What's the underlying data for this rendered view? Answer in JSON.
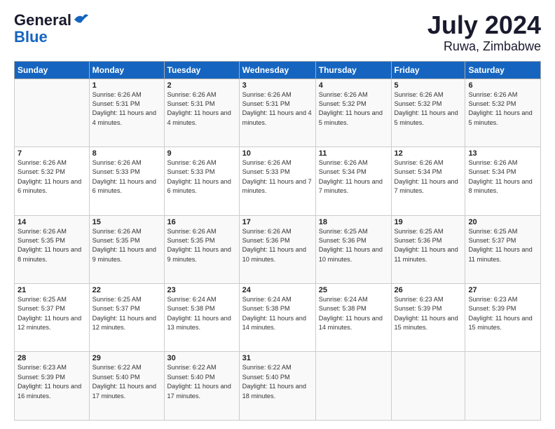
{
  "header": {
    "logo_general": "General",
    "logo_blue": "Blue",
    "title": "July 2024",
    "subtitle": "Ruwa, Zimbabwe"
  },
  "days_of_week": [
    "Sunday",
    "Monday",
    "Tuesday",
    "Wednesday",
    "Thursday",
    "Friday",
    "Saturday"
  ],
  "weeks": [
    [
      {
        "day": "",
        "sunrise": "",
        "sunset": "",
        "daylight": ""
      },
      {
        "day": "1",
        "sunrise": "Sunrise: 6:26 AM",
        "sunset": "Sunset: 5:31 PM",
        "daylight": "Daylight: 11 hours and 4 minutes."
      },
      {
        "day": "2",
        "sunrise": "Sunrise: 6:26 AM",
        "sunset": "Sunset: 5:31 PM",
        "daylight": "Daylight: 11 hours and 4 minutes."
      },
      {
        "day": "3",
        "sunrise": "Sunrise: 6:26 AM",
        "sunset": "Sunset: 5:31 PM",
        "daylight": "Daylight: 11 hours and 4 minutes."
      },
      {
        "day": "4",
        "sunrise": "Sunrise: 6:26 AM",
        "sunset": "Sunset: 5:32 PM",
        "daylight": "Daylight: 11 hours and 5 minutes."
      },
      {
        "day": "5",
        "sunrise": "Sunrise: 6:26 AM",
        "sunset": "Sunset: 5:32 PM",
        "daylight": "Daylight: 11 hours and 5 minutes."
      },
      {
        "day": "6",
        "sunrise": "Sunrise: 6:26 AM",
        "sunset": "Sunset: 5:32 PM",
        "daylight": "Daylight: 11 hours and 5 minutes."
      }
    ],
    [
      {
        "day": "7",
        "sunrise": "Sunrise: 6:26 AM",
        "sunset": "Sunset: 5:32 PM",
        "daylight": "Daylight: 11 hours and 6 minutes."
      },
      {
        "day": "8",
        "sunrise": "Sunrise: 6:26 AM",
        "sunset": "Sunset: 5:33 PM",
        "daylight": "Daylight: 11 hours and 6 minutes."
      },
      {
        "day": "9",
        "sunrise": "Sunrise: 6:26 AM",
        "sunset": "Sunset: 5:33 PM",
        "daylight": "Daylight: 11 hours and 6 minutes."
      },
      {
        "day": "10",
        "sunrise": "Sunrise: 6:26 AM",
        "sunset": "Sunset: 5:33 PM",
        "daylight": "Daylight: 11 hours and 7 minutes."
      },
      {
        "day": "11",
        "sunrise": "Sunrise: 6:26 AM",
        "sunset": "Sunset: 5:34 PM",
        "daylight": "Daylight: 11 hours and 7 minutes."
      },
      {
        "day": "12",
        "sunrise": "Sunrise: 6:26 AM",
        "sunset": "Sunset: 5:34 PM",
        "daylight": "Daylight: 11 hours and 7 minutes."
      },
      {
        "day": "13",
        "sunrise": "Sunrise: 6:26 AM",
        "sunset": "Sunset: 5:34 PM",
        "daylight": "Daylight: 11 hours and 8 minutes."
      }
    ],
    [
      {
        "day": "14",
        "sunrise": "Sunrise: 6:26 AM",
        "sunset": "Sunset: 5:35 PM",
        "daylight": "Daylight: 11 hours and 8 minutes."
      },
      {
        "day": "15",
        "sunrise": "Sunrise: 6:26 AM",
        "sunset": "Sunset: 5:35 PM",
        "daylight": "Daylight: 11 hours and 9 minutes."
      },
      {
        "day": "16",
        "sunrise": "Sunrise: 6:26 AM",
        "sunset": "Sunset: 5:35 PM",
        "daylight": "Daylight: 11 hours and 9 minutes."
      },
      {
        "day": "17",
        "sunrise": "Sunrise: 6:26 AM",
        "sunset": "Sunset: 5:36 PM",
        "daylight": "Daylight: 11 hours and 10 minutes."
      },
      {
        "day": "18",
        "sunrise": "Sunrise: 6:25 AM",
        "sunset": "Sunset: 5:36 PM",
        "daylight": "Daylight: 11 hours and 10 minutes."
      },
      {
        "day": "19",
        "sunrise": "Sunrise: 6:25 AM",
        "sunset": "Sunset: 5:36 PM",
        "daylight": "Daylight: 11 hours and 11 minutes."
      },
      {
        "day": "20",
        "sunrise": "Sunrise: 6:25 AM",
        "sunset": "Sunset: 5:37 PM",
        "daylight": "Daylight: 11 hours and 11 minutes."
      }
    ],
    [
      {
        "day": "21",
        "sunrise": "Sunrise: 6:25 AM",
        "sunset": "Sunset: 5:37 PM",
        "daylight": "Daylight: 11 hours and 12 minutes."
      },
      {
        "day": "22",
        "sunrise": "Sunrise: 6:25 AM",
        "sunset": "Sunset: 5:37 PM",
        "daylight": "Daylight: 11 hours and 12 minutes."
      },
      {
        "day": "23",
        "sunrise": "Sunrise: 6:24 AM",
        "sunset": "Sunset: 5:38 PM",
        "daylight": "Daylight: 11 hours and 13 minutes."
      },
      {
        "day": "24",
        "sunrise": "Sunrise: 6:24 AM",
        "sunset": "Sunset: 5:38 PM",
        "daylight": "Daylight: 11 hours and 14 minutes."
      },
      {
        "day": "25",
        "sunrise": "Sunrise: 6:24 AM",
        "sunset": "Sunset: 5:38 PM",
        "daylight": "Daylight: 11 hours and 14 minutes."
      },
      {
        "day": "26",
        "sunrise": "Sunrise: 6:23 AM",
        "sunset": "Sunset: 5:39 PM",
        "daylight": "Daylight: 11 hours and 15 minutes."
      },
      {
        "day": "27",
        "sunrise": "Sunrise: 6:23 AM",
        "sunset": "Sunset: 5:39 PM",
        "daylight": "Daylight: 11 hours and 15 minutes."
      }
    ],
    [
      {
        "day": "28",
        "sunrise": "Sunrise: 6:23 AM",
        "sunset": "Sunset: 5:39 PM",
        "daylight": "Daylight: 11 hours and 16 minutes."
      },
      {
        "day": "29",
        "sunrise": "Sunrise: 6:22 AM",
        "sunset": "Sunset: 5:40 PM",
        "daylight": "Daylight: 11 hours and 17 minutes."
      },
      {
        "day": "30",
        "sunrise": "Sunrise: 6:22 AM",
        "sunset": "Sunset: 5:40 PM",
        "daylight": "Daylight: 11 hours and 17 minutes."
      },
      {
        "day": "31",
        "sunrise": "Sunrise: 6:22 AM",
        "sunset": "Sunset: 5:40 PM",
        "daylight": "Daylight: 11 hours and 18 minutes."
      },
      {
        "day": "",
        "sunrise": "",
        "sunset": "",
        "daylight": ""
      },
      {
        "day": "",
        "sunrise": "",
        "sunset": "",
        "daylight": ""
      },
      {
        "day": "",
        "sunrise": "",
        "sunset": "",
        "daylight": ""
      }
    ]
  ]
}
